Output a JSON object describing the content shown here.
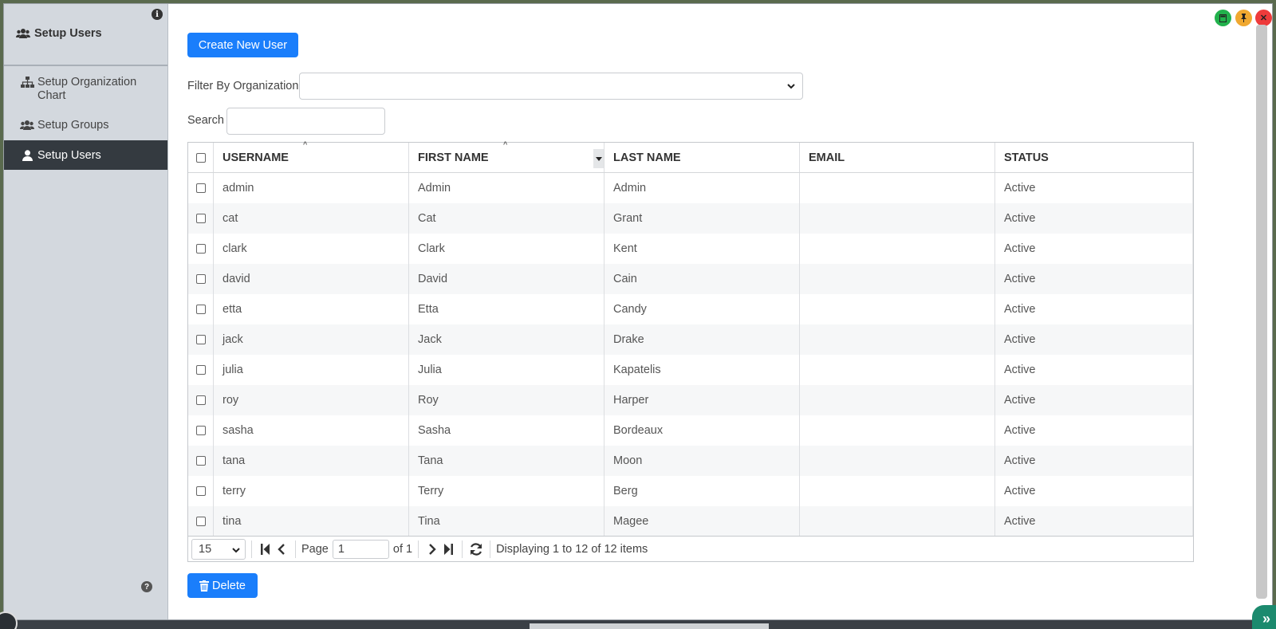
{
  "sidebar": {
    "title": "Setup Users",
    "items": [
      {
        "label": "Setup Organization Chart",
        "icon": "sitemap-icon"
      },
      {
        "label": "Setup Groups",
        "icon": "users-icon"
      },
      {
        "label": "Setup Users",
        "icon": "user-icon",
        "active": true
      }
    ]
  },
  "main": {
    "create_button": "Create New User",
    "filter_label": "Filter By Organization",
    "filter_value": "",
    "search_label": "Search",
    "search_value": "",
    "delete_button": "Delete"
  },
  "grid": {
    "columns": [
      "USERNAME",
      "FIRST NAME",
      "LAST NAME",
      "EMAIL",
      "STATUS"
    ],
    "rows": [
      [
        "admin",
        "Admin",
        "Admin",
        "",
        "Active"
      ],
      [
        "cat",
        "Cat",
        "Grant",
        "",
        "Active"
      ],
      [
        "clark",
        "Clark",
        "Kent",
        "",
        "Active"
      ],
      [
        "david",
        "David",
        "Cain",
        "",
        "Active"
      ],
      [
        "etta",
        "Etta",
        "Candy",
        "",
        "Active"
      ],
      [
        "jack",
        "Jack",
        "Drake",
        "",
        "Active"
      ],
      [
        "julia",
        "Julia",
        "Kapatelis",
        "",
        "Active"
      ],
      [
        "roy",
        "Roy",
        "Harper",
        "",
        "Active"
      ],
      [
        "sasha",
        "Sasha",
        "Bordeaux",
        "",
        "Active"
      ],
      [
        "tana",
        "Tana",
        "Moon",
        "",
        "Active"
      ],
      [
        "terry",
        "Terry",
        "Berg",
        "",
        "Active"
      ],
      [
        "tina",
        "Tina",
        "Magee",
        "",
        "Active"
      ]
    ]
  },
  "pager": {
    "page_size": "15",
    "page_label": "Page",
    "page_value": "1",
    "of_label": "of 1",
    "display_text": "Displaying 1 to 12 of 12 items"
  },
  "colors": {
    "primary": "#1a7efb",
    "sidebar_bg": "#d3d8de",
    "sidebar_active": "#343a40",
    "win_green": "#22b14c",
    "win_yellow": "#f0a830",
    "win_red": "#ee3b3b"
  }
}
